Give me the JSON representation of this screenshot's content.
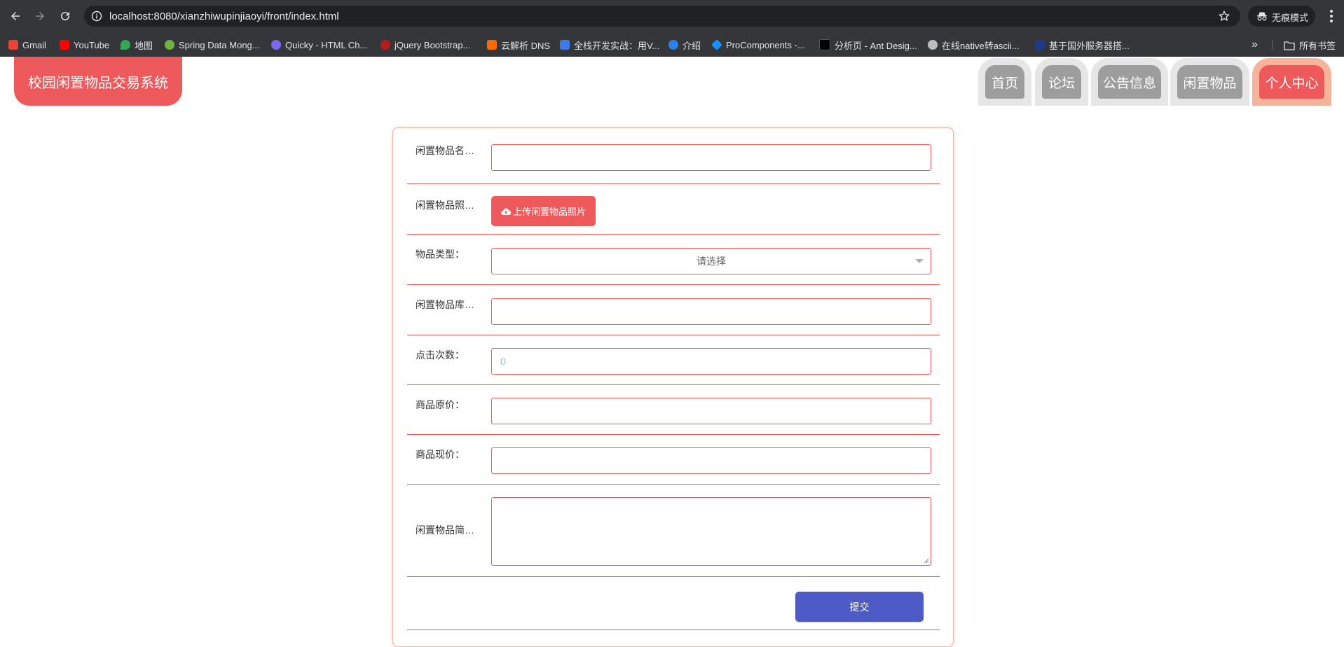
{
  "browser": {
    "url": "localhost:8080/xianzhiwupinjiaoyi/front/index.html",
    "incognito_label": "无痕模式",
    "all_bookmarks_label": "所有书签",
    "bookmarks": [
      {
        "label": "Gmail",
        "icon": "gmail-icon",
        "color": "#ea4335"
      },
      {
        "label": "YouTube",
        "icon": "youtube-icon",
        "color": "#ff0000"
      },
      {
        "label": "地图",
        "icon": "maps-icon",
        "color": "#34a853"
      },
      {
        "label": "Spring Data Mong...",
        "icon": "spring-icon",
        "color": "#6db33f"
      },
      {
        "label": "Quicky - HTML Ch...",
        "icon": "quicky-icon",
        "color": "#7b68ee"
      },
      {
        "label": "jQuery Bootstrap...",
        "icon": "jquery-icon",
        "color": "#b71c1c"
      },
      {
        "label": "云解析 DNS",
        "icon": "aliyun-icon",
        "color": "#ff6a00"
      },
      {
        "label": "全栈开发实战：用V...",
        "icon": "m-icon",
        "color": "#3d7bea"
      },
      {
        "label": "介绍",
        "icon": "globe-icon",
        "color": "#2a82e4"
      },
      {
        "label": "ProComponents -...",
        "icon": "antd-icon",
        "color": "#1890ff"
      },
      {
        "label": "分析页 - Ant Desig...",
        "icon": "pro-icon",
        "color": "#000000"
      },
      {
        "label": "在线native转ascii...",
        "icon": "web-icon",
        "color": "#bdbdbd"
      },
      {
        "label": "基于国外服务器搭...",
        "icon": "flag-icon",
        "color": "#1e3a8a"
      }
    ]
  },
  "site": {
    "title": "校园闲置物品交易系统",
    "nav": [
      {
        "label": "首页",
        "active": false
      },
      {
        "label": "论坛",
        "active": false
      },
      {
        "label": "公告信息",
        "active": false
      },
      {
        "label": "闲置物品",
        "active": false
      },
      {
        "label": "个人中心",
        "active": true
      }
    ]
  },
  "form": {
    "name_label": "闲置物品名称：",
    "name_value": "",
    "photo_label": "闲置物品照片：",
    "upload_button": "上传闲置物品照片",
    "type_label": "物品类型：",
    "type_placeholder": "请选择",
    "stock_label": "闲置物品库存：",
    "stock_value": "",
    "clicks_label": "点击次数：",
    "clicks_value": "0",
    "orig_price_label": "商品原价：",
    "orig_price_value": "",
    "curr_price_label": "商品现价：",
    "curr_price_value": "",
    "intro_label": "闲置物品简介：",
    "intro_value": "",
    "submit_button": "提交"
  },
  "colors": {
    "accent": "#ee5a5c",
    "submit": "#4e5bc6",
    "nav_inactive": "#9d9d9d"
  }
}
